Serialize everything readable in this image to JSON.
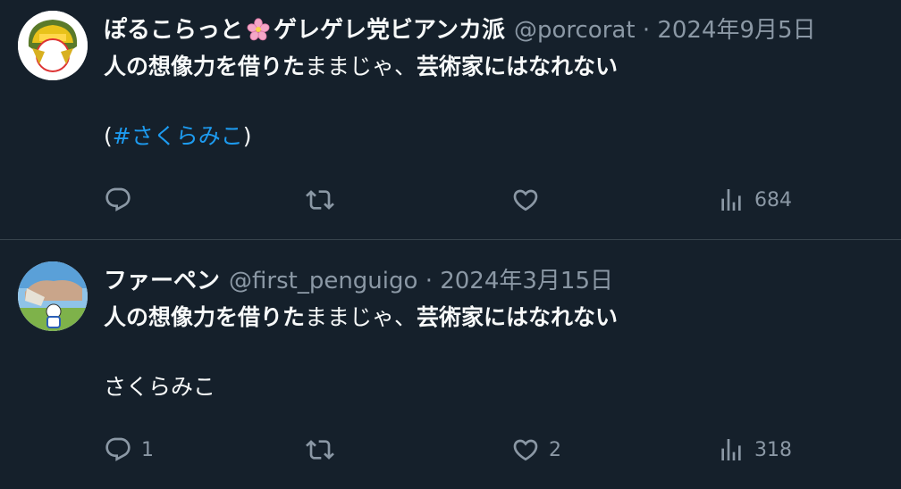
{
  "tweets": [
    {
      "display_name_a": "ぽるこらっと",
      "display_name_b": "ゲレゲレ党ビアンカ派",
      "handle": "@porcorat",
      "separator": "·",
      "date": "2024年9月5日",
      "line1_bold_a": "人の想像力を借りた",
      "line1_regular": "ままじゃ、",
      "line1_bold_b": "芸術家にはなれない",
      "line3_open": "(",
      "hashtag": "#さくらみこ",
      "line3_close": ")",
      "replies": "",
      "retweets": "",
      "likes": "",
      "views": "684"
    },
    {
      "display_name": "ファーペン",
      "handle": "@first_penguigo",
      "separator": "·",
      "date": "2024年3月15日",
      "line1_bold_a": "人の想像力を借りた",
      "line1_regular": "ままじゃ、",
      "line1_bold_b": "芸術家にはなれない",
      "line3": "さくらみこ",
      "replies": "1",
      "retweets": "",
      "likes": "2",
      "views": "318"
    }
  ],
  "colors": {
    "background": "#15202b",
    "text": "#f7f9f9",
    "muted": "#8b98a5",
    "link": "#1d9bf0",
    "divider": "#38444d"
  },
  "icons": [
    "reply-icon",
    "retweet-icon",
    "like-icon",
    "views-icon",
    "cherry-blossom-icon"
  ]
}
